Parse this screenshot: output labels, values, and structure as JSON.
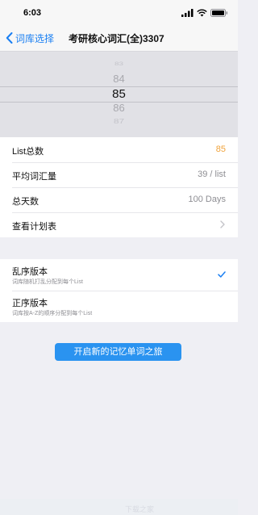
{
  "status_bar": {
    "time": "6:03",
    "icons": [
      "signal-icon",
      "wifi-icon",
      "battery-icon"
    ]
  },
  "nav": {
    "back_label": "词库选择",
    "title": "考研核心词汇(全)3307"
  },
  "picker": {
    "values": [
      "83",
      "84",
      "85",
      "86",
      "87"
    ],
    "selected": "85"
  },
  "stats": {
    "rows": [
      {
        "label": "List总数",
        "value": "85"
      },
      {
        "label": "平均词汇量",
        "value": "39 / list"
      },
      {
        "label": "总天数",
        "value": "100 Days"
      },
      {
        "label": "查看计划表",
        "value": ""
      }
    ]
  },
  "versions": {
    "options": [
      {
        "title": "乱序版本",
        "subtitle": "词库随机打乱分配到每个List",
        "selected": true
      },
      {
        "title": "正序版本",
        "subtitle": "词库按A-Z的顺序分配到每个List",
        "selected": false
      }
    ]
  },
  "start_button": {
    "label": "开启新的记忆单词之旅"
  },
  "footer": {
    "watermark": "下载之家"
  },
  "colors": {
    "accent_blue": "#1a7ff2",
    "button_blue": "#2a93f0",
    "highlight_orange": "#f0a33b",
    "background": "#efeff4"
  }
}
